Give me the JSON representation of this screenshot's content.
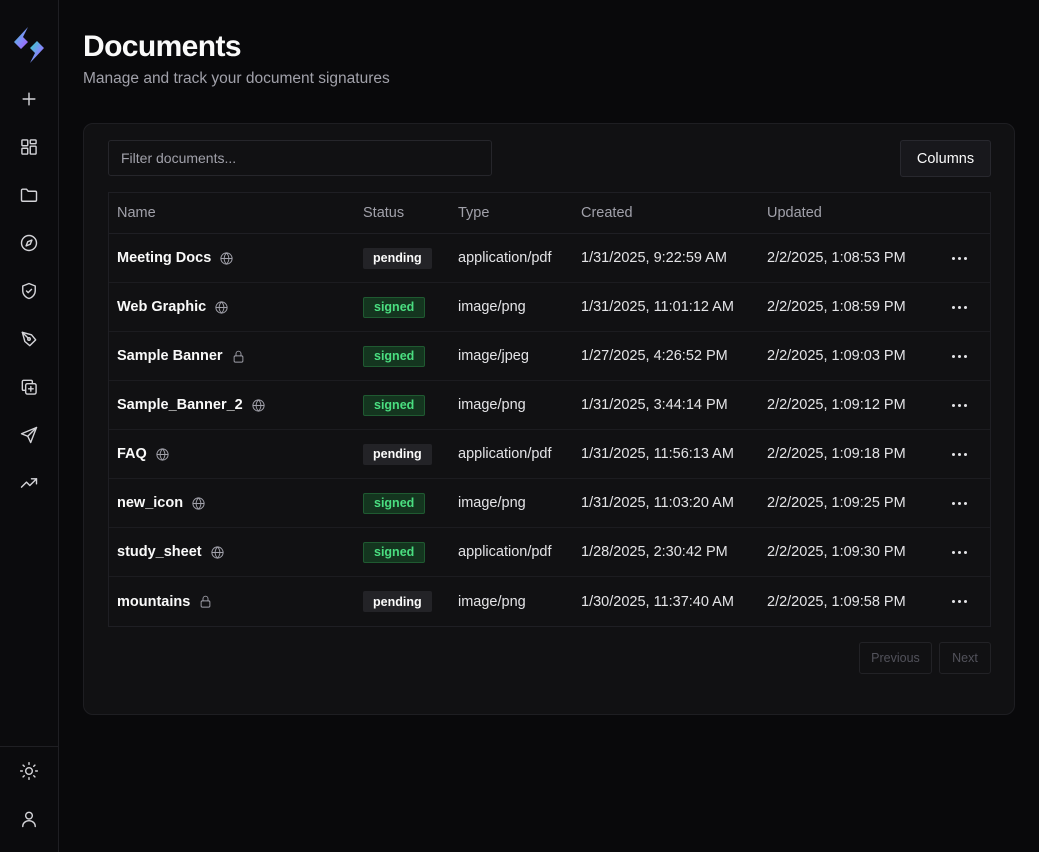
{
  "colors": {
    "accent_gradient": [
      "#2dd4bf",
      "#818cf8",
      "#a855f7"
    ],
    "signed_bg": "#14351f",
    "signed_text": "#4ade80",
    "pending_bg": "#232327"
  },
  "sidebar": {
    "logo_icon": "app-logo",
    "items": [
      {
        "icon": "plus-icon",
        "label": "New"
      },
      {
        "icon": "dashboard-grid-icon",
        "label": "Dashboard"
      },
      {
        "icon": "folder-icon",
        "label": "Documents"
      },
      {
        "icon": "compass-icon",
        "label": "Explore"
      },
      {
        "icon": "shield-check-icon",
        "label": "Security"
      },
      {
        "icon": "pen-tool-icon",
        "label": "Sign"
      },
      {
        "icon": "copy-plus-icon",
        "label": "Templates"
      },
      {
        "icon": "send-icon",
        "label": "Send"
      },
      {
        "icon": "trending-up-icon",
        "label": "Analytics"
      }
    ],
    "footer_items": [
      {
        "icon": "sun-icon",
        "label": "Theme"
      },
      {
        "icon": "user-icon",
        "label": "Profile"
      }
    ]
  },
  "header": {
    "title": "Documents",
    "subtitle": "Manage and track your document signatures"
  },
  "toolbar": {
    "filter_placeholder": "Filter documents...",
    "filter_value": "",
    "columns_label": "Columns"
  },
  "table": {
    "columns": [
      "Name",
      "Status",
      "Type",
      "Created",
      "Updated"
    ],
    "rows": [
      {
        "name": "Meeting Docs",
        "visibility": "globe-icon",
        "status": "pending",
        "type": "application/pdf",
        "created": "1/31/2025, 9:22:59 AM",
        "updated": "2/2/2025, 1:08:53 PM"
      },
      {
        "name": "Web Graphic",
        "visibility": "globe-icon",
        "status": "signed",
        "type": "image/png",
        "created": "1/31/2025, 11:01:12 AM",
        "updated": "2/2/2025, 1:08:59 PM"
      },
      {
        "name": "Sample Banner",
        "visibility": "lock-icon",
        "status": "signed",
        "type": "image/jpeg",
        "created": "1/27/2025, 4:26:52 PM",
        "updated": "2/2/2025, 1:09:03 PM"
      },
      {
        "name": "Sample_Banner_2",
        "visibility": "globe-icon",
        "status": "signed",
        "type": "image/png",
        "created": "1/31/2025, 3:44:14 PM",
        "updated": "2/2/2025, 1:09:12 PM"
      },
      {
        "name": "FAQ",
        "visibility": "globe-icon",
        "status": "pending",
        "type": "application/pdf",
        "created": "1/31/2025, 11:56:13 AM",
        "updated": "2/2/2025, 1:09:18 PM"
      },
      {
        "name": "new_icon",
        "visibility": "globe-icon",
        "status": "signed",
        "type": "image/png",
        "created": "1/31/2025, 11:03:20 AM",
        "updated": "2/2/2025, 1:09:25 PM"
      },
      {
        "name": "study_sheet",
        "visibility": "globe-icon",
        "status": "signed",
        "type": "application/pdf",
        "created": "1/28/2025, 2:30:42 PM",
        "updated": "2/2/2025, 1:09:30 PM"
      },
      {
        "name": "mountains",
        "visibility": "lock-icon",
        "status": "pending",
        "type": "image/png",
        "created": "1/30/2025, 11:37:40 AM",
        "updated": "2/2/2025, 1:09:58 PM"
      }
    ]
  },
  "pagination": {
    "previous_label": "Previous",
    "next_label": "Next"
  }
}
